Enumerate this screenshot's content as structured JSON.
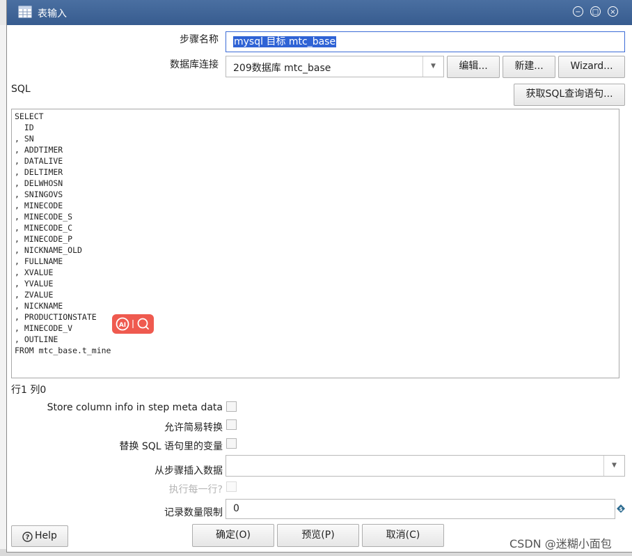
{
  "window": {
    "title": "表输入",
    "buttons": {
      "minimize": "−",
      "maximize": "□",
      "close": "×"
    }
  },
  "step_name": {
    "label": "步骤名称",
    "value": "mysql 目标  mtc_base"
  },
  "db_connection": {
    "label": "数据库连接",
    "value": "209数据库 mtc_base",
    "edit_button": "编辑...",
    "new_button": "新建...",
    "wizard_button": "Wizard..."
  },
  "sql": {
    "label": "SQL",
    "get_sql_button": "获取SQL查询语句...",
    "text": "SELECT\n  ID\n, SN\n, ADDTIMER\n, DATALIVE\n, DELTIMER\n, DELWHOSN\n, SNINGOVS\n, MINECODE\n, MINECODE_S\n, MINECODE_C\n, MINECODE_P\n, NICKNAME_OLD\n, FULLNAME\n, XVALUE\n, YVALUE\n, ZVALUE\n, NICKNAME\n, PRODUCTIONSTATE\n, MINECODE_V\n, OUTLINE\nFROM mtc_base.t_mine",
    "cursor_position": "行1 列0"
  },
  "options": {
    "store_column_info": "Store column info in step meta data",
    "lazy_conversion": "允许简易转换",
    "replace_variables": "替换 SQL 语句里的变量",
    "insert_from_step": "从步骤插入数据",
    "insert_from_step_value": "",
    "execute_each_row": "执行每一行?",
    "limit_label": "记录数量限制",
    "limit_value": "0"
  },
  "footer": {
    "help_button": "Help",
    "ok_button": "确定(O)",
    "preview_button": "预览(P)",
    "cancel_button": "取消(C)"
  },
  "icons": {
    "title": "table-input-icon",
    "help": "question-circle-icon",
    "variable": "diamond-variable-icon",
    "ai": "ai-assistant-icon"
  },
  "colors": {
    "titlebar": "#375c8f",
    "selection": "#2f63d5",
    "ai_badge": "#ef5a4f"
  },
  "watermark": "CSDN @迷糊小面包"
}
